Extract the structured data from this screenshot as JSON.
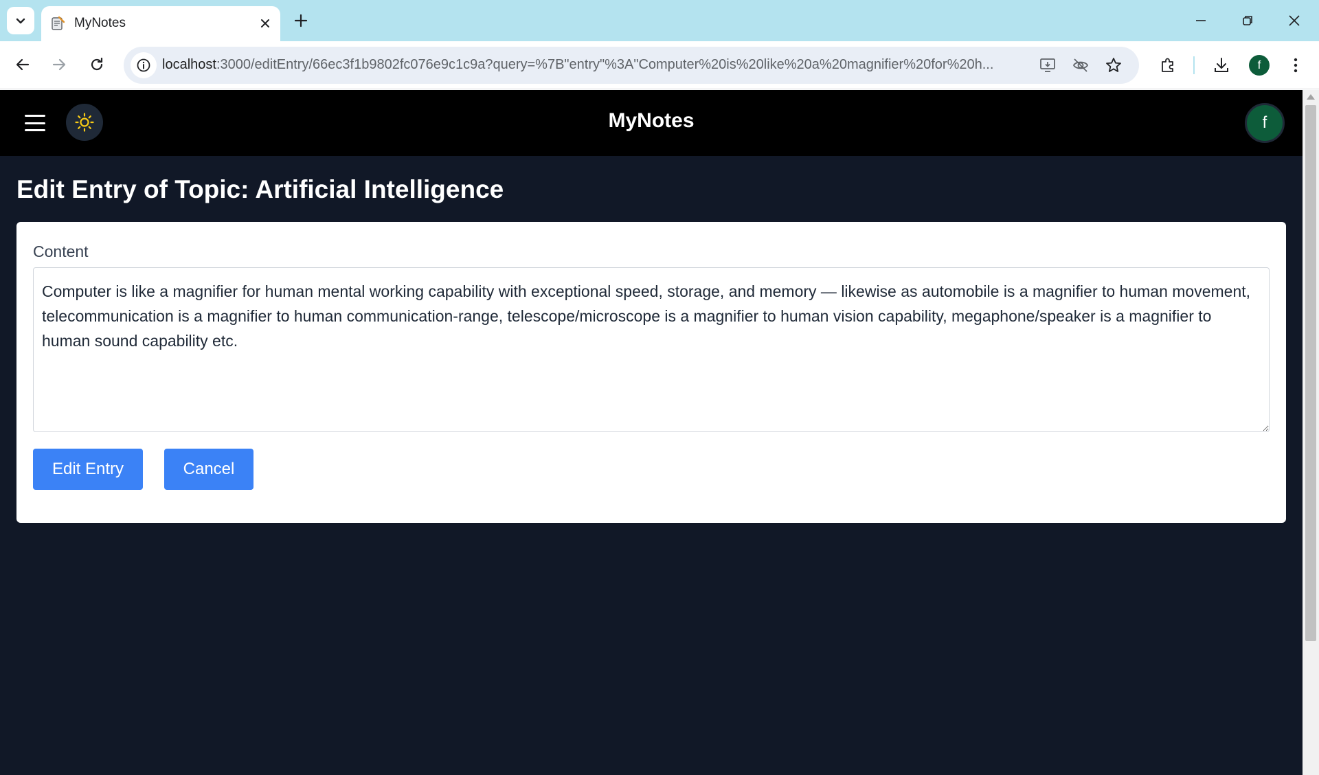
{
  "browser": {
    "tab_title": "MyNotes",
    "url_host": "localhost",
    "url_rest": ":3000/editEntry/66ec3f1b9802fc076e9c1c9a?query=%7B\"entry\"%3A\"Computer%20is%20like%20a%20magnifier%20for%20h...",
    "profile_initial": "f"
  },
  "header": {
    "app_title": "MyNotes",
    "avatar_initial": "f"
  },
  "main": {
    "heading": "Edit Entry of Topic: Artificial Intelligence",
    "content_label": "Content",
    "content_value": "Computer is like a magnifier for human mental working capability with exceptional speed, storage, and memory — likewise as automobile is a magnifier to human movement, telecommunication is a magnifier to human communication-range, telescope/microscope is a magnifier to human vision capability, megaphone/speaker is a magnifier to human sound capability etc.",
    "edit_button": "Edit Entry",
    "cancel_button": "Cancel"
  },
  "colors": {
    "page_bg": "#111827",
    "header_bg": "#000000",
    "button": "#3b82f6",
    "avatar": "#0d5c3a",
    "sun": "#facc15"
  }
}
